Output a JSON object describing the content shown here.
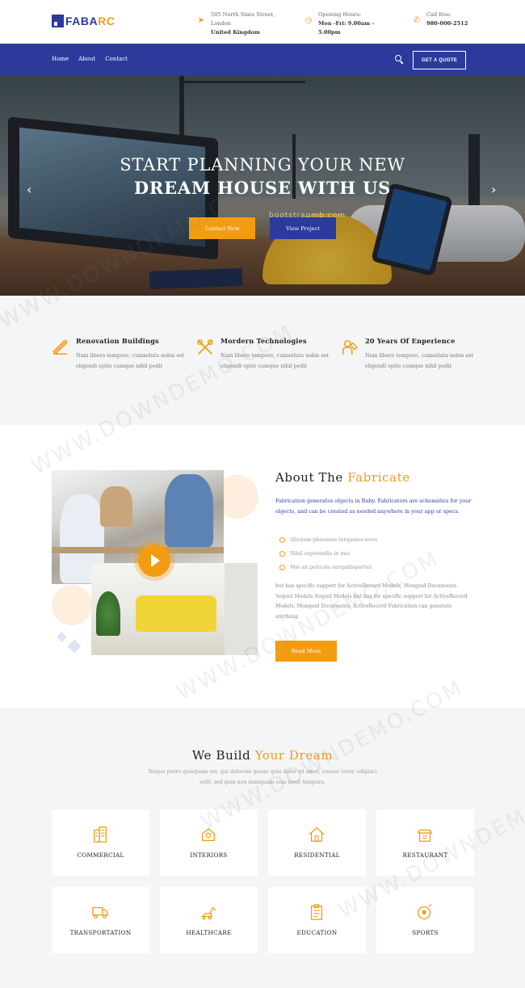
{
  "header": {
    "logo": {
      "text_main": "FABA",
      "text_accent": "RC"
    },
    "address": {
      "line1": "505 North State Street,",
      "line2": "London",
      "line3": "United Kingdom"
    },
    "hours": {
      "label": "Opening Hours:",
      "line1": "Mon -Fri: 9.00am -",
      "line2": "5.00pm"
    },
    "phone": {
      "label": "Call free:",
      "number": "980-000-2512"
    }
  },
  "nav": {
    "links": [
      "Home",
      "About",
      "Contact"
    ],
    "quote_button": "GET A QUOTE"
  },
  "hero": {
    "line1": "START PLANNING YOUR NEW",
    "line2": "DREAM HOUSE WITH US",
    "primary_button": "Contact Now",
    "secondary_button": "View Project",
    "prev_arrow": "‹",
    "next_arrow": "›",
    "watermark": "bootstrapmb.com"
  },
  "features": [
    {
      "icon": "ruler-pencil-icon",
      "title": "Renovation Buildings",
      "text": "Nam libero tempore, cumsoluta nobis est eligendi optio cumque nihil pedit"
    },
    {
      "icon": "tools-icon",
      "title": "Mordern Technologies",
      "text": "Nam libero tempore, cumsoluta nobis est eligendi optio cumque nihil pedit"
    },
    {
      "icon": "worker-icon",
      "title": "20 Years Of Enperience",
      "text": "Nam libero tempore, cumsoluta nobis est eligendi optio cumque nihil pedit"
    }
  ],
  "about": {
    "title_main": "About The ",
    "title_accent": "Fabricate",
    "lead": "Fabrication generates objects in Ruby. Fabricators are schematics for your objects, and can be created as needed anywhere in your app or specs.",
    "list": [
      "Allenum phoenum torquatos nevo",
      "Nihil expetendis in mei",
      "Mei an pericula euripidisparten"
    ],
    "body": "but has specific support for ActiveRecord Models, Mongoid Documents. Sequel Models Sequel Models but has for specific support for ActiveRecord Models, Mongoid Documents, ActiveRecord Fabrication can generate anything.",
    "button": "Read More"
  },
  "services": {
    "title_main": "We Build ",
    "title_accent": "Your Dream",
    "subtitle": "Neque porro quisquam est, qui dolorem ipsum quia dolor sit amet, consec tetur, adipisci velit, sed quia non numquam eius modi tempora.",
    "cards": [
      {
        "label": "COMMERCIAL",
        "icon": "building-icon"
      },
      {
        "label": "INTERIORS",
        "icon": "house-key-icon"
      },
      {
        "label": "RESIDENTIAL",
        "icon": "residential-house-icon"
      },
      {
        "label": "RESTAURANT",
        "icon": "restaurant-icon"
      },
      {
        "label": "TRANSPORTATION",
        "icon": "truck-icon"
      },
      {
        "label": "HEALTHCARE",
        "icon": "excavator-icon"
      },
      {
        "label": "EDUCATION",
        "icon": "clipboard-icon"
      },
      {
        "label": "SPORTS",
        "icon": "ball-icon"
      }
    ]
  },
  "colors": {
    "brand_blue": "#2b3a9b",
    "accent_orange": "#f39c12"
  }
}
